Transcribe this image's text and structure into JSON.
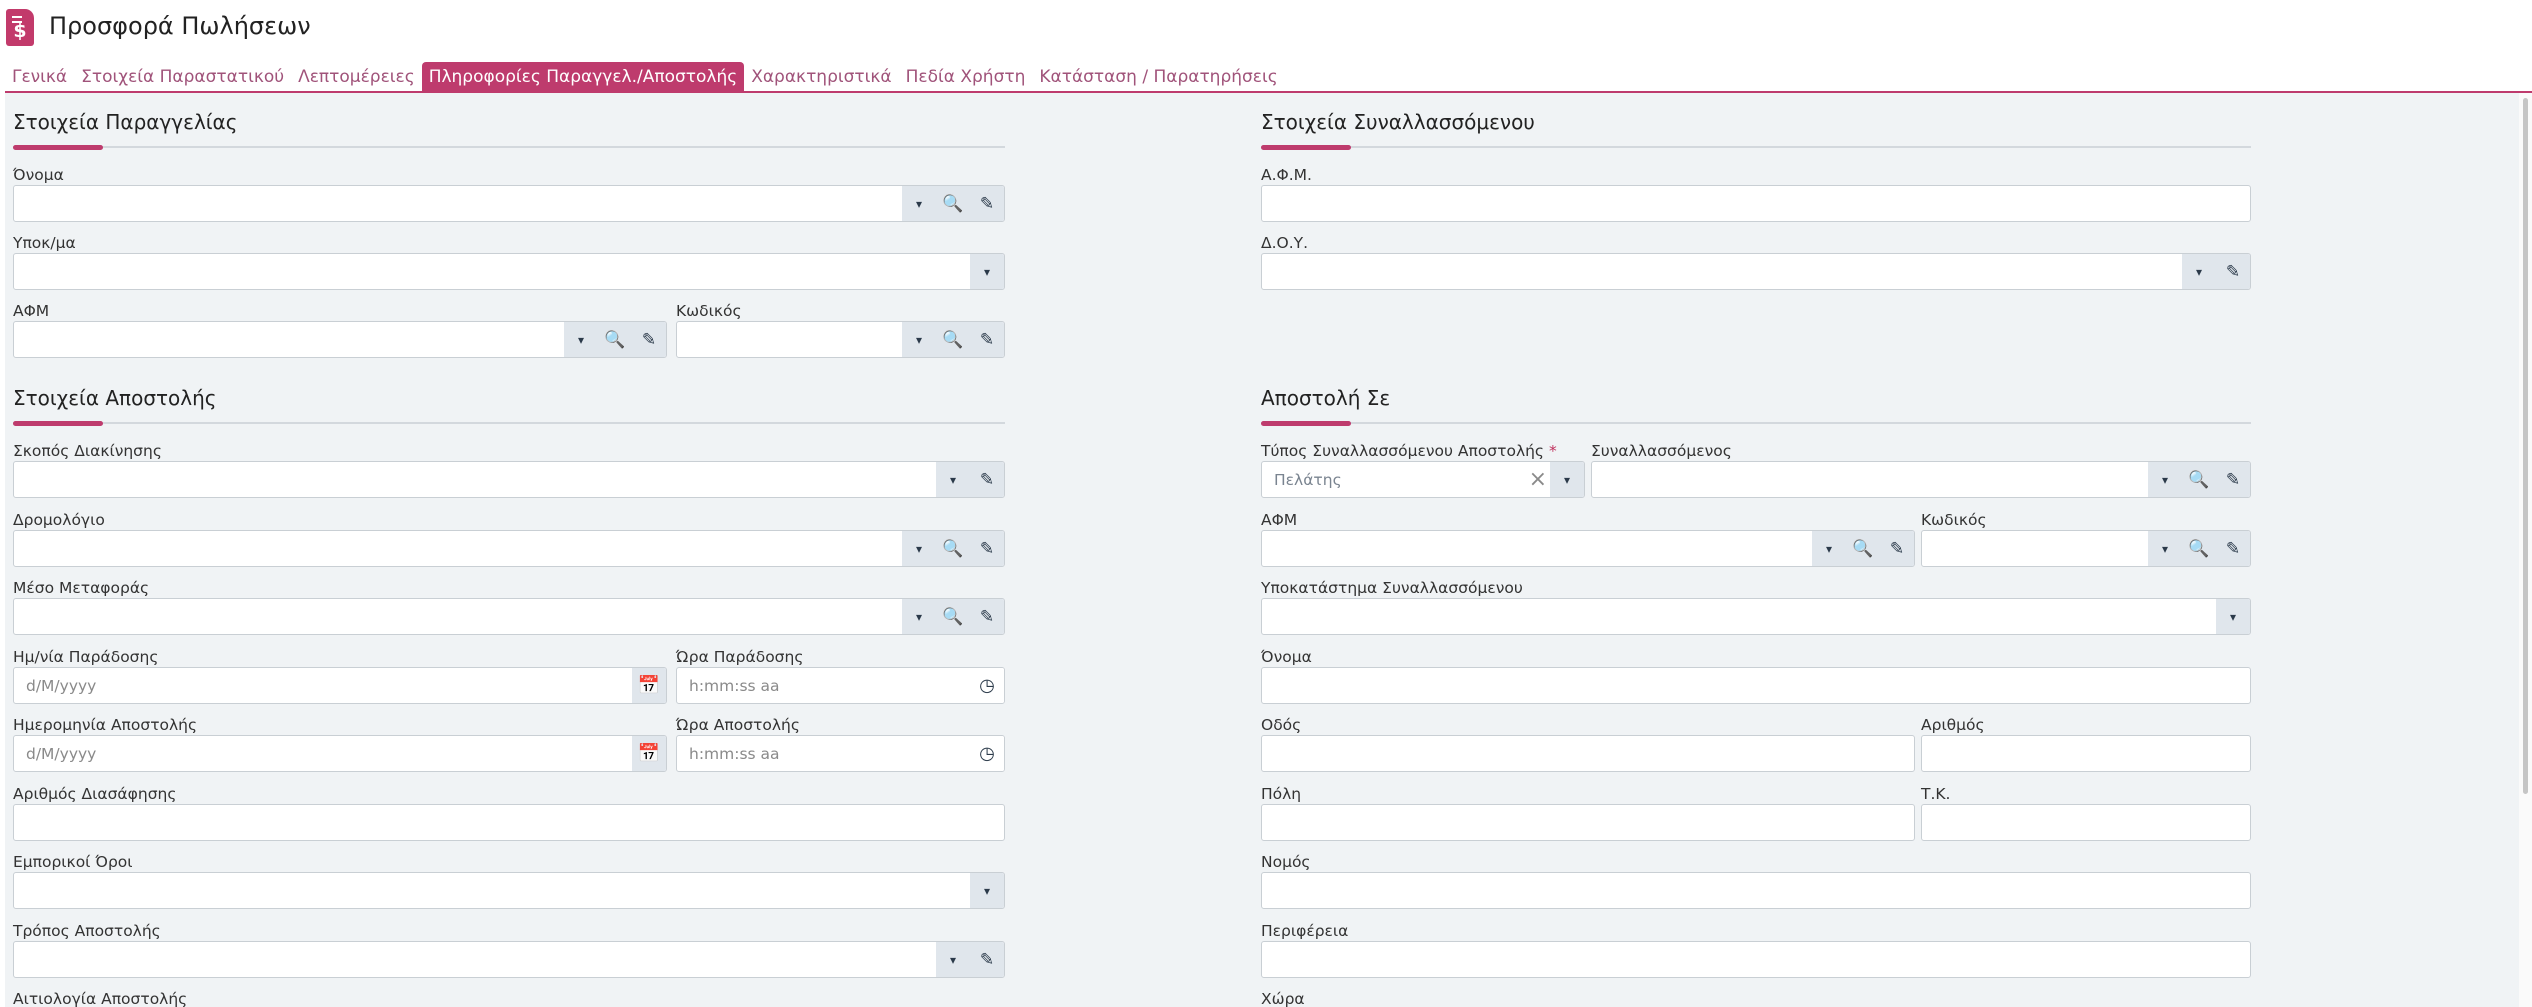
{
  "header": {
    "title": "Προσφορά Πωλήσεων",
    "logo_symbol": "$"
  },
  "tabs": [
    {
      "label": "Γενικά",
      "active": false
    },
    {
      "label": "Στοιχεία Παραστατικού",
      "active": false
    },
    {
      "label": "Λεπτομέρειες",
      "active": false
    },
    {
      "label": "Πληροφορίες Παραγγελ./Αποστολής",
      "active": true
    },
    {
      "label": "Χαρακτηριστικά",
      "active": false
    },
    {
      "label": "Πεδία Χρήστη",
      "active": false
    },
    {
      "label": "Κατάσταση / Παρατηρήσεις",
      "active": false
    }
  ],
  "order_section": {
    "title": "Στοιχεία Παραγγελίας",
    "name_label": "Όνομα",
    "branch_label": "Υποκ/μα",
    "vat_label": "ΑΦΜ",
    "code_label": "Κωδικός"
  },
  "trader_section": {
    "title": "Στοιχεία Συναλλασσόμενου",
    "vat_label": "Α.Φ.Μ.",
    "tax_office_label": "Δ.Ο.Υ."
  },
  "shipping_section": {
    "title": "Στοιχεία Αποστολής",
    "purpose_label": "Σκοπός Διακίνησης",
    "route_label": "Δρομολόγιο",
    "transport_label": "Μέσο Μεταφοράς",
    "delivery_date_label": "Ημ/νία Παράδοσης",
    "delivery_time_label": "Ώρα Παράδοσης",
    "ship_date_label": "Ημερομηνία Αποστολής",
    "ship_time_label": "Ώρα Αποστολής",
    "declaration_label": "Αριθμός Διασάφησης",
    "terms_label": "Εμπορικοί Όροι",
    "method_label": "Τρόπος Αποστολής",
    "reason_label": "Αιτιολογία Αποστολής",
    "date_placeholder": "d/M/yyyy",
    "time_placeholder": "h:mm:ss aa"
  },
  "ship_to_section": {
    "title": "Αποστολή Σε",
    "trader_type_label": "Τύπος Συναλλασσόμενου Αποστολής",
    "required_mark": "*",
    "trader_type_value": "Πελάτης",
    "trader_label": "Συναλλασσόμενος",
    "vat_label": "ΑΦΜ",
    "code_label": "Κωδικός",
    "trader_branch_label": "Υποκατάστημα Συναλλασσόμενου",
    "name_label": "Όνομα",
    "street_label": "Οδός",
    "number_label": "Αριθμός",
    "city_label": "Πόλη",
    "zip_label": "Τ.Κ.",
    "prefecture_label": "Νομός",
    "region_label": "Περιφέρεια",
    "country_label": "Χώρα"
  },
  "icons": {
    "caret": "▾",
    "search": "🔍",
    "edit": "✎",
    "calendar": "📅",
    "clock": "◷",
    "clear": "×"
  }
}
